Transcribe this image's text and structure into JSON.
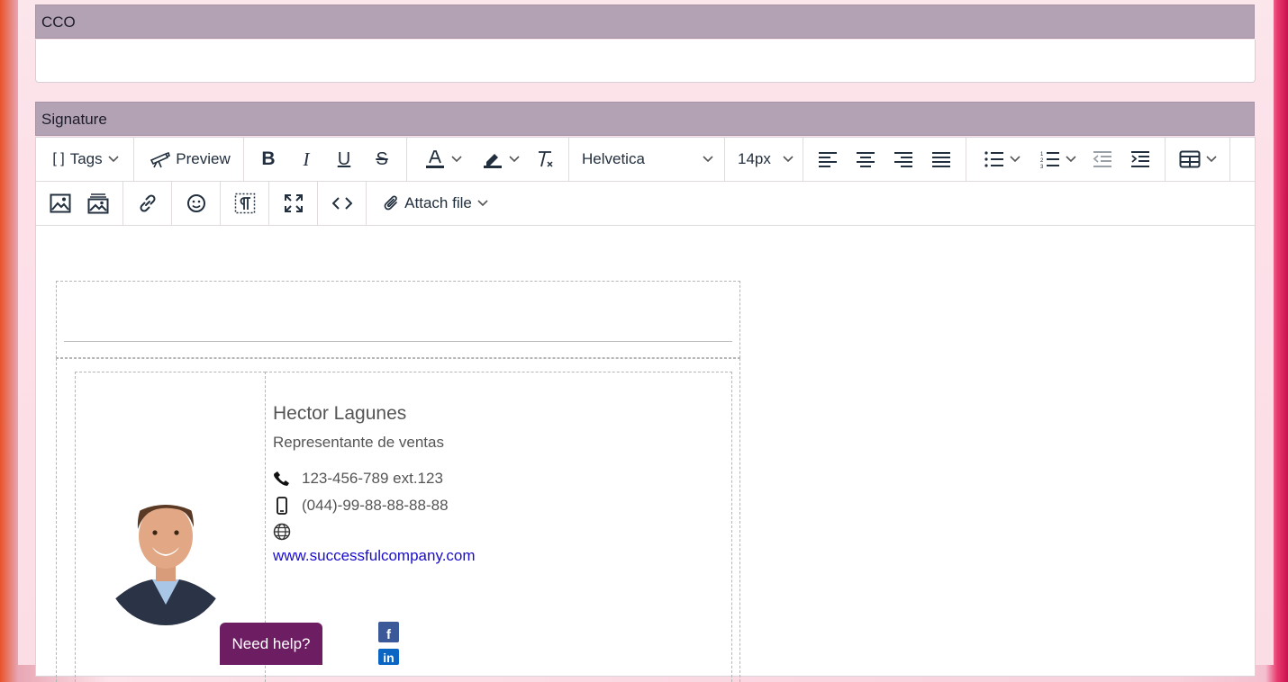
{
  "cco": {
    "label": "CCO",
    "value": ""
  },
  "signature": {
    "label": "Signature"
  },
  "toolbar": {
    "tags_label": "Tags",
    "preview_label": "Preview",
    "font_family": "Helvetica",
    "font_size": "14px",
    "attach_label": "Attach file"
  },
  "sig": {
    "name": "Hector Lagunes",
    "role": "Representante de ventas",
    "phone": "123-456-789 ext.123",
    "mobile": "(044)-99-88-88-88-88",
    "website": "www.successfulcompany.com"
  },
  "help": {
    "label": "Need help?"
  },
  "colors": {
    "header_bg": "#b3a2b3",
    "link": "#1a0dcc",
    "help_button": "#6d1e63",
    "facebook": "#3b5998",
    "linkedin": "#0a66c2"
  },
  "icons": {
    "social": [
      "facebook-icon",
      "linkedin-icon"
    ]
  }
}
